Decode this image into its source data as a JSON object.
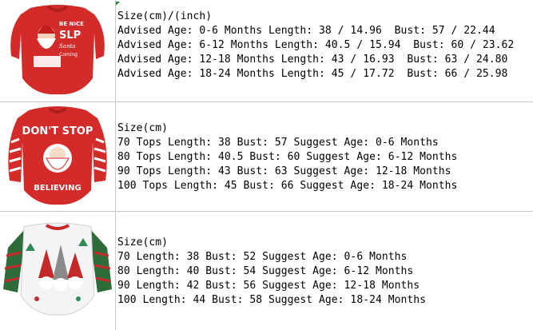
{
  "rows": [
    {
      "image": "red santa romper with white lettering",
      "image_text": [
        "BE NICE",
        "SLP",
        "Santa",
        "Coming"
      ],
      "lines": [
        "Size(cm)/(inch)",
        "Advised Age: 0-6 Months Length: 38 / 14.96  Bust: 57 / 22.44",
        "Advised Age: 6-12 Months Length: 40.5 / 15.94  Bust: 60 / 23.62",
        "Advised Age: 12-18 Months Length: 43 / 16.93  Bust: 63 / 24.80",
        "Advised Age: 18-24 Months Length: 45 / 17.72  Bust: 66 / 25.98"
      ]
    },
    {
      "image": "red striped-sleeve santa romper",
      "image_text": [
        "DON'T STOP",
        "BELIEVING"
      ],
      "lines": [
        "Size(cm)",
        "70 Tops Length: 38 Bust: 57 Suggest Age: 0-6 Months",
        "80 Tops Length: 40.5 Bust: 60 Suggest Age: 6-12 Months",
        "90 Tops Length: 43 Bust: 63 Suggest Age: 12-18 Months",
        "100 Tops Length: 45 Bust: 66 Suggest Age: 18-24 Months"
      ]
    },
    {
      "image": "white gnome print romper with plaid sleeves",
      "lines": [
        "Size(cm)",
        "70 Length: 38 Bust: 52 Suggest Age: 0-6 Months",
        "80 Length: 40 Bust: 54 Suggest Age: 6-12 Months",
        "90 Length: 42 Bust: 56 Suggest Age: 12-18 Months",
        "100 Length: 44 Bust: 58 Suggest Age: 18-24 Months"
      ]
    }
  ],
  "colors": {
    "grid": "#c8c8c8",
    "romper_red": "#d32a2a",
    "plaid_green": "#2e6b3a"
  }
}
